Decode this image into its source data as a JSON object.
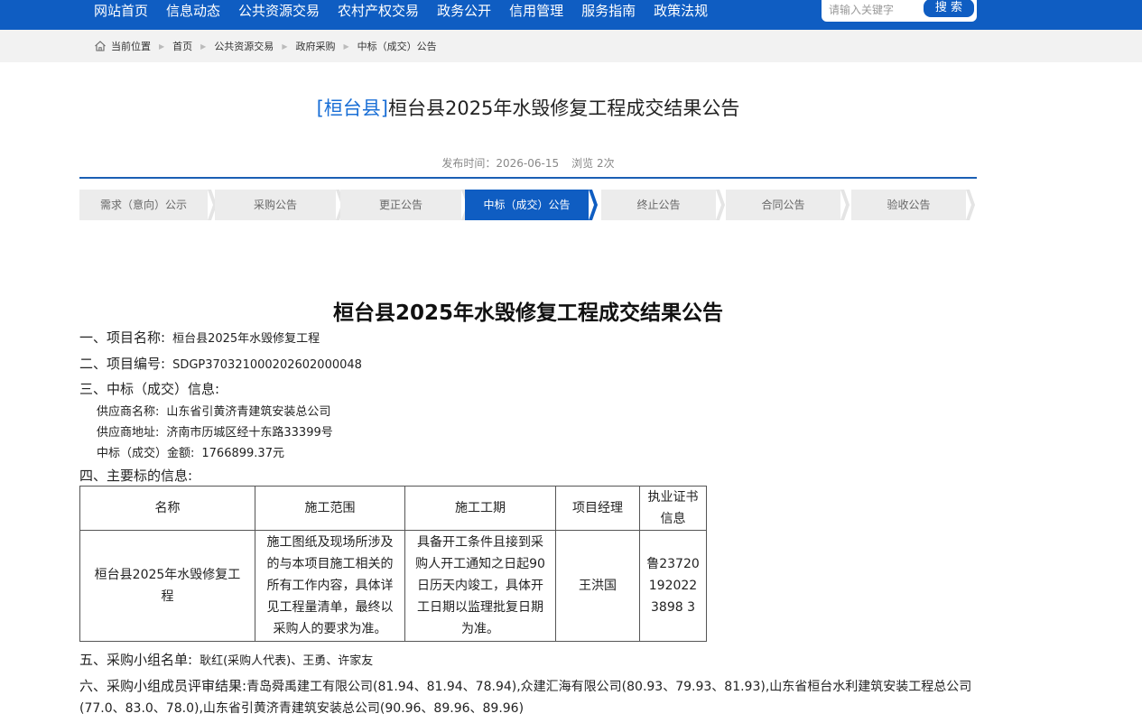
{
  "nav": {
    "items": [
      "网站首页",
      "信息动态",
      "公共资源交易",
      "农村产权交易",
      "政务公开",
      "信用管理",
      "服务指南",
      "政策法规"
    ],
    "search_placeholder": "请输入关键字",
    "search_label": "搜 索"
  },
  "breadcrumb": {
    "label": "当前位置",
    "items": [
      "首页",
      "公共资源交易",
      "政府采购",
      "中标（成交）公告"
    ]
  },
  "header": {
    "tag": "[桓台县]",
    "title": "桓台县2025年水毁修复工程成交结果公告",
    "publish": "发布时间：2026-06-15",
    "views": "浏览 2次"
  },
  "steps": [
    "需求（意向）公示",
    "采购公告",
    "更正公告",
    "中标（成交）公告",
    "终止公告",
    "合同公告",
    "验收公告"
  ],
  "active_step": 3,
  "article": {
    "title": "桓台县2025年水毁修复工程成交结果公告",
    "s1_label": "一、项目名称:",
    "s1_value": "桓台县2025年水毁修复工程",
    "s2_label": "二、项目编号:",
    "s2_value": "SDGP370321000202602000048",
    "s3_label": "三、中标（成交）信息:",
    "supplier_name_label": "供应商名称:",
    "supplier_name": "山东省引黄济青建筑安装总公司",
    "supplier_addr_label": "供应商地址:",
    "supplier_addr": "济南市历城区经十东路33399号",
    "amount_label": "中标（成交）金额:",
    "amount": "1766899.37元",
    "s4_label": "四、主要标的信息:",
    "table": {
      "headers": [
        "名称",
        "施工范围",
        "施工工期",
        "项目经理",
        "执业证书信息"
      ],
      "row": [
        "桓台县2025年水毁修复工程",
        "施工图纸及现场所涉及的与本项目施工相关的所有工作内容，具体详见工程量清单，最终以采购人的要求为准。",
        "具备开工条件且接到采购人开工通知之日起90日历天内竣工，具体开工日期以监理批复日期为准。",
        "王洪国",
        "鲁237201920223898 3"
      ]
    },
    "s5_label": "五、采购小组名单:",
    "s5_value": "耿红(采购人代表)、王勇、许家友",
    "s6_label": "六、采购小组成员评审结果:",
    "s6_value": "青岛舜禹建工有限公司(81.94、81.94、78.94),众建汇海有限公司(80.93、79.93、81.93),山东省桓台水利建筑安装工程总公司(77.0、83.0、78.0),山东省引黄济青建筑安装总公司(90.96、89.96、89.96)"
  }
}
